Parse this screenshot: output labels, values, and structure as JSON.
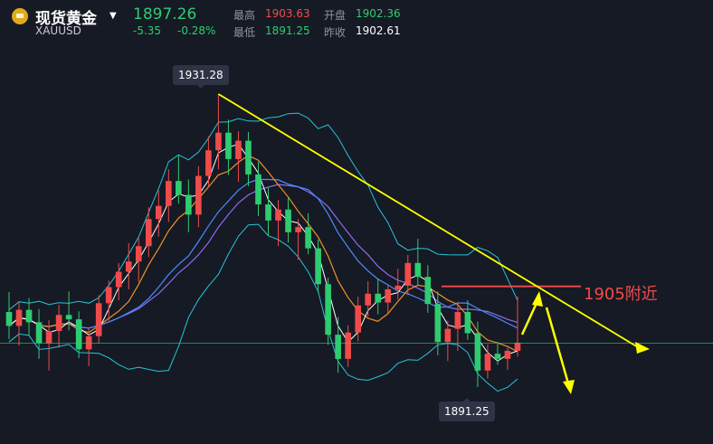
{
  "header": {
    "name": "现货黄金",
    "code": "XAUUSD",
    "price": "1897.26",
    "change": "-5.35",
    "change_pct": "-0.28%",
    "high_label": "最高",
    "high_value": "1903.63",
    "open_label": "开盘",
    "open_value": "1902.36",
    "low_label": "最低",
    "low_value": "1891.25",
    "prev_close_label": "昨收",
    "prev_close_value": "1902.61"
  },
  "annotations": {
    "peak_label": "1931.28",
    "low_label": "1891.25",
    "resistance_label": "1905附近"
  },
  "colors": {
    "background": "#161a24",
    "up": "#f04b4b",
    "down": "#2ecc71",
    "trend_line": "#ffff00",
    "bollinger": "#28c4d8",
    "ma_purple": "#8b6cf2",
    "ma_blue": "#4a8bff",
    "ma_orange": "#f0902a",
    "ma_white": "#ffffff"
  },
  "chart_data": {
    "type": "candlestick",
    "symbol": "XAUUSD",
    "ohlc_approx": [
      [
        1901.5,
        1904.2,
        1897.8,
        1899.6
      ],
      [
        1899.6,
        1903.0,
        1896.9,
        1901.8
      ],
      [
        1901.8,
        1903.4,
        1898.2,
        1900.1
      ],
      [
        1900.1,
        1901.9,
        1895.1,
        1897.2
      ],
      [
        1897.2,
        1900.4,
        1893.5,
        1898.9
      ],
      [
        1898.9,
        1902.5,
        1896.6,
        1901.1
      ],
      [
        1901.1,
        1904.3,
        1899.0,
        1900.5
      ],
      [
        1900.5,
        1901.6,
        1895.2,
        1896.4
      ],
      [
        1896.4,
        1899.3,
        1894.1,
        1898.2
      ],
      [
        1898.2,
        1903.8,
        1897.2,
        1902.7
      ],
      [
        1902.7,
        1905.8,
        1900.3,
        1904.9
      ],
      [
        1904.9,
        1908.2,
        1903.1,
        1907.0
      ],
      [
        1907.0,
        1910.9,
        1904.6,
        1908.4
      ],
      [
        1908.4,
        1911.6,
        1905.6,
        1910.5
      ],
      [
        1910.5,
        1915.8,
        1909.0,
        1914.2
      ],
      [
        1914.2,
        1918.1,
        1911.8,
        1916.0
      ],
      [
        1916.0,
        1921.0,
        1913.8,
        1919.4
      ],
      [
        1919.4,
        1922.9,
        1916.3,
        1917.5
      ],
      [
        1917.5,
        1919.6,
        1912.4,
        1914.8
      ],
      [
        1914.8,
        1921.4,
        1913.1,
        1920.1
      ],
      [
        1920.1,
        1925.5,
        1918.5,
        1923.6
      ],
      [
        1923.6,
        1931.28,
        1921.0,
        1926.0
      ],
      [
        1926.0,
        1927.8,
        1920.2,
        1922.4
      ],
      [
        1922.4,
        1926.2,
        1919.3,
        1924.9
      ],
      [
        1924.9,
        1926.1,
        1918.7,
        1920.3
      ],
      [
        1920.3,
        1922.0,
        1914.6,
        1916.2
      ],
      [
        1916.2,
        1918.5,
        1911.9,
        1914.0
      ],
      [
        1914.0,
        1916.8,
        1910.5,
        1915.5
      ],
      [
        1915.5,
        1917.1,
        1911.0,
        1912.4
      ],
      [
        1912.4,
        1914.2,
        1908.6,
        1913.1
      ],
      [
        1913.1,
        1915.0,
        1909.4,
        1910.2
      ],
      [
        1910.2,
        1911.4,
        1904.1,
        1905.3
      ],
      [
        1905.3,
        1906.2,
        1897.0,
        1898.4
      ],
      [
        1898.4,
        1900.8,
        1893.2,
        1895.1
      ],
      [
        1895.1,
        1899.7,
        1894.0,
        1898.7
      ],
      [
        1898.7,
        1903.6,
        1897.5,
        1902.4
      ],
      [
        1902.4,
        1905.7,
        1900.9,
        1904.0
      ],
      [
        1904.0,
        1906.1,
        1901.2,
        1902.8
      ],
      [
        1902.8,
        1905.2,
        1901.3,
        1904.6
      ],
      [
        1904.6,
        1907.4,
        1903.2,
        1905.1
      ],
      [
        1905.1,
        1909.3,
        1903.8,
        1908.2
      ],
      [
        1908.2,
        1911.5,
        1905.1,
        1906.3
      ],
      [
        1906.3,
        1907.9,
        1901.4,
        1902.6
      ],
      [
        1902.6,
        1904.3,
        1895.6,
        1897.4
      ],
      [
        1897.4,
        1900.3,
        1894.8,
        1899.2
      ],
      [
        1899.2,
        1902.9,
        1896.2,
        1901.5
      ],
      [
        1901.5,
        1903.1,
        1897.7,
        1898.6
      ],
      [
        1898.6,
        1900.2,
        1891.25,
        1893.5
      ],
      [
        1893.5,
        1897.1,
        1892.4,
        1895.8
      ],
      [
        1895.8,
        1897.4,
        1894.3,
        1895.1
      ],
      [
        1895.1,
        1896.6,
        1893.6,
        1896.2
      ],
      [
        1896.2,
        1903.63,
        1895.4,
        1897.26
      ]
    ]
  }
}
